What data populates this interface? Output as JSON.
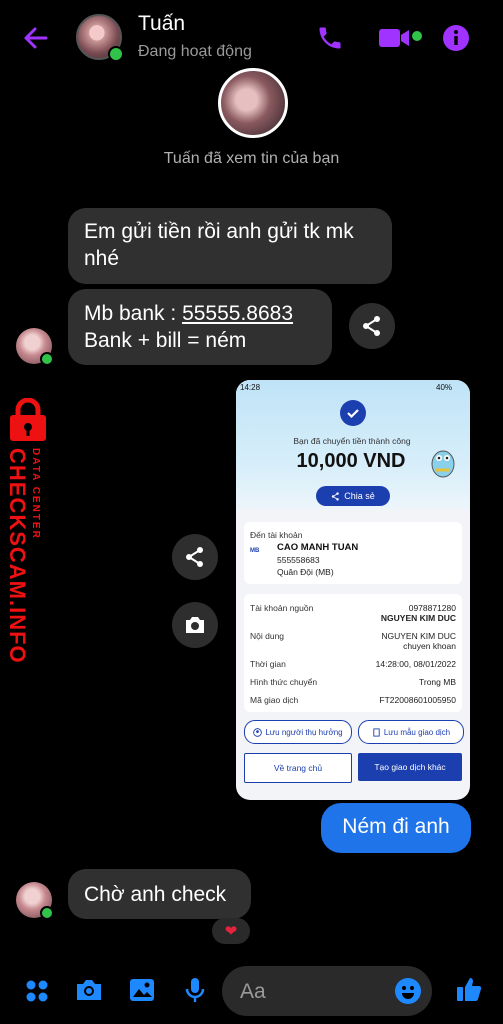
{
  "header": {
    "name": "Tuấn",
    "status": "Đang hoạt động"
  },
  "seen_text": "Tuấn đã xem tin của bạn",
  "messages": {
    "msg1": "Em gửi tiền rồi anh gửi tk mk nhé",
    "msg2_prefix": "Mb bank : ",
    "msg2_account": "55555.8683",
    "msg2_line2": "Bank + bill = ném",
    "msg_out": "Ném đi anh",
    "msg_last": "Chờ anh check",
    "reaction": "❤"
  },
  "watermark": {
    "title": "CHECKSCAM.INFO",
    "subtitle": "DATA CENTER"
  },
  "receipt": {
    "status_time": "14:28",
    "status_battery": "40%",
    "headline": "Bạn đã chuyển tiền thành công",
    "amount": "10,000 VND",
    "share_label": "Chia sẻ",
    "to_account_label": "Đến tài khoản",
    "bank_logo": "MB",
    "recipient_name": "CAO MANH TUAN",
    "recipient_account": "555558683",
    "recipient_bank": "Quân Đội (MB)",
    "rows": [
      {
        "k": "Tài khoản nguồn",
        "v1": "0978871280",
        "v2": "NGUYEN KIM DUC"
      },
      {
        "k": "Nội dung",
        "v1": "NGUYEN KIM DUC",
        "v2": "chuyen khoan"
      },
      {
        "k": "Thời gian",
        "v1": "14:28:00, 08/01/2022",
        "v2": ""
      },
      {
        "k": "Hình thức chuyển",
        "v1": "Trong MB",
        "v2": ""
      },
      {
        "k": "Mã giao dịch",
        "v1": "FT22008601005950",
        "v2": ""
      }
    ],
    "save_recipient": "Lưu người thụ hưởng",
    "save_template": "Lưu mẫu giao dịch",
    "home_button": "Về trang chủ",
    "new_transaction": "Tạo giao dịch khác"
  },
  "composer": {
    "placeholder": "Aa"
  },
  "colors": {
    "accent": "#a033ff",
    "bubble_out": "#1e74e8",
    "bubble_in": "#303030",
    "online": "#31c24a",
    "mb_blue": "#1c3faf"
  }
}
